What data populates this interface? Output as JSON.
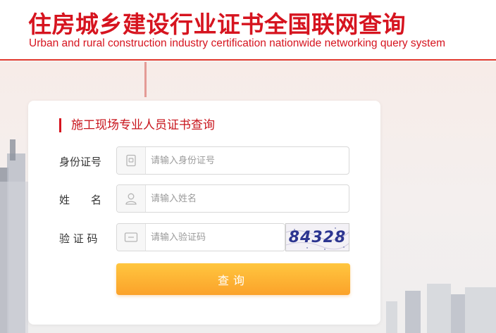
{
  "header": {
    "title_cn": "住房城乡建设行业证书全国联网查询",
    "title_en": "Urban and rural construction industry certification nationwide networking query system"
  },
  "form": {
    "title": "施工现场专业人员证书查询",
    "id_label": "身份证号",
    "id_placeholder": "请输入身份证号",
    "name_label": "姓　　名",
    "name_placeholder": "请输入姓名",
    "captcha_label": "验 证 码",
    "captcha_placeholder": "请输入验证码",
    "captcha_text": "84328",
    "submit_label": "查询"
  },
  "colors": {
    "brand_red": "#d6141f",
    "button_orange": "#fba22a"
  },
  "icons": {
    "id": "id-card-icon",
    "name": "user-icon",
    "captcha": "captcha-icon"
  }
}
